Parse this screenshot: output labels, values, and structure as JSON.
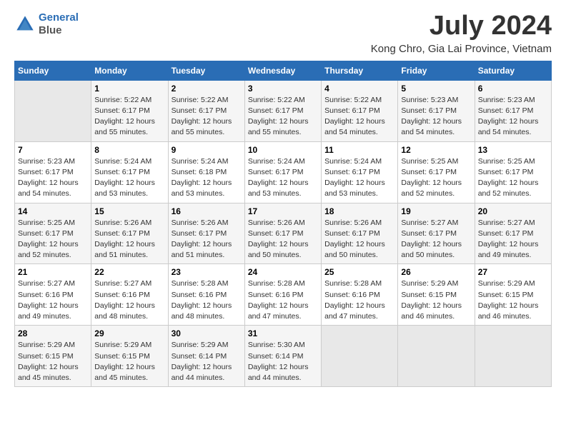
{
  "header": {
    "logo_line1": "General",
    "logo_line2": "Blue",
    "title": "July 2024",
    "subtitle": "Kong Chro, Gia Lai Province, Vietnam"
  },
  "calendar": {
    "days_of_week": [
      "Sunday",
      "Monday",
      "Tuesday",
      "Wednesday",
      "Thursday",
      "Friday",
      "Saturday"
    ],
    "weeks": [
      [
        {
          "num": "",
          "info": ""
        },
        {
          "num": "1",
          "info": "Sunrise: 5:22 AM\nSunset: 6:17 PM\nDaylight: 12 hours\nand 55 minutes."
        },
        {
          "num": "2",
          "info": "Sunrise: 5:22 AM\nSunset: 6:17 PM\nDaylight: 12 hours\nand 55 minutes."
        },
        {
          "num": "3",
          "info": "Sunrise: 5:22 AM\nSunset: 6:17 PM\nDaylight: 12 hours\nand 55 minutes."
        },
        {
          "num": "4",
          "info": "Sunrise: 5:22 AM\nSunset: 6:17 PM\nDaylight: 12 hours\nand 54 minutes."
        },
        {
          "num": "5",
          "info": "Sunrise: 5:23 AM\nSunset: 6:17 PM\nDaylight: 12 hours\nand 54 minutes."
        },
        {
          "num": "6",
          "info": "Sunrise: 5:23 AM\nSunset: 6:17 PM\nDaylight: 12 hours\nand 54 minutes."
        }
      ],
      [
        {
          "num": "7",
          "info": "Sunrise: 5:23 AM\nSunset: 6:17 PM\nDaylight: 12 hours\nand 54 minutes."
        },
        {
          "num": "8",
          "info": "Sunrise: 5:24 AM\nSunset: 6:17 PM\nDaylight: 12 hours\nand 53 minutes."
        },
        {
          "num": "9",
          "info": "Sunrise: 5:24 AM\nSunset: 6:18 PM\nDaylight: 12 hours\nand 53 minutes."
        },
        {
          "num": "10",
          "info": "Sunrise: 5:24 AM\nSunset: 6:17 PM\nDaylight: 12 hours\nand 53 minutes."
        },
        {
          "num": "11",
          "info": "Sunrise: 5:24 AM\nSunset: 6:17 PM\nDaylight: 12 hours\nand 53 minutes."
        },
        {
          "num": "12",
          "info": "Sunrise: 5:25 AM\nSunset: 6:17 PM\nDaylight: 12 hours\nand 52 minutes."
        },
        {
          "num": "13",
          "info": "Sunrise: 5:25 AM\nSunset: 6:17 PM\nDaylight: 12 hours\nand 52 minutes."
        }
      ],
      [
        {
          "num": "14",
          "info": "Sunrise: 5:25 AM\nSunset: 6:17 PM\nDaylight: 12 hours\nand 52 minutes."
        },
        {
          "num": "15",
          "info": "Sunrise: 5:26 AM\nSunset: 6:17 PM\nDaylight: 12 hours\nand 51 minutes."
        },
        {
          "num": "16",
          "info": "Sunrise: 5:26 AM\nSunset: 6:17 PM\nDaylight: 12 hours\nand 51 minutes."
        },
        {
          "num": "17",
          "info": "Sunrise: 5:26 AM\nSunset: 6:17 PM\nDaylight: 12 hours\nand 50 minutes."
        },
        {
          "num": "18",
          "info": "Sunrise: 5:26 AM\nSunset: 6:17 PM\nDaylight: 12 hours\nand 50 minutes."
        },
        {
          "num": "19",
          "info": "Sunrise: 5:27 AM\nSunset: 6:17 PM\nDaylight: 12 hours\nand 50 minutes."
        },
        {
          "num": "20",
          "info": "Sunrise: 5:27 AM\nSunset: 6:17 PM\nDaylight: 12 hours\nand 49 minutes."
        }
      ],
      [
        {
          "num": "21",
          "info": "Sunrise: 5:27 AM\nSunset: 6:16 PM\nDaylight: 12 hours\nand 49 minutes."
        },
        {
          "num": "22",
          "info": "Sunrise: 5:27 AM\nSunset: 6:16 PM\nDaylight: 12 hours\nand 48 minutes."
        },
        {
          "num": "23",
          "info": "Sunrise: 5:28 AM\nSunset: 6:16 PM\nDaylight: 12 hours\nand 48 minutes."
        },
        {
          "num": "24",
          "info": "Sunrise: 5:28 AM\nSunset: 6:16 PM\nDaylight: 12 hours\nand 47 minutes."
        },
        {
          "num": "25",
          "info": "Sunrise: 5:28 AM\nSunset: 6:16 PM\nDaylight: 12 hours\nand 47 minutes."
        },
        {
          "num": "26",
          "info": "Sunrise: 5:29 AM\nSunset: 6:15 PM\nDaylight: 12 hours\nand 46 minutes."
        },
        {
          "num": "27",
          "info": "Sunrise: 5:29 AM\nSunset: 6:15 PM\nDaylight: 12 hours\nand 46 minutes."
        }
      ],
      [
        {
          "num": "28",
          "info": "Sunrise: 5:29 AM\nSunset: 6:15 PM\nDaylight: 12 hours\nand 45 minutes."
        },
        {
          "num": "29",
          "info": "Sunrise: 5:29 AM\nSunset: 6:15 PM\nDaylight: 12 hours\nand 45 minutes."
        },
        {
          "num": "30",
          "info": "Sunrise: 5:29 AM\nSunset: 6:14 PM\nDaylight: 12 hours\nand 44 minutes."
        },
        {
          "num": "31",
          "info": "Sunrise: 5:30 AM\nSunset: 6:14 PM\nDaylight: 12 hours\nand 44 minutes."
        },
        {
          "num": "",
          "info": ""
        },
        {
          "num": "",
          "info": ""
        },
        {
          "num": "",
          "info": ""
        }
      ]
    ]
  }
}
